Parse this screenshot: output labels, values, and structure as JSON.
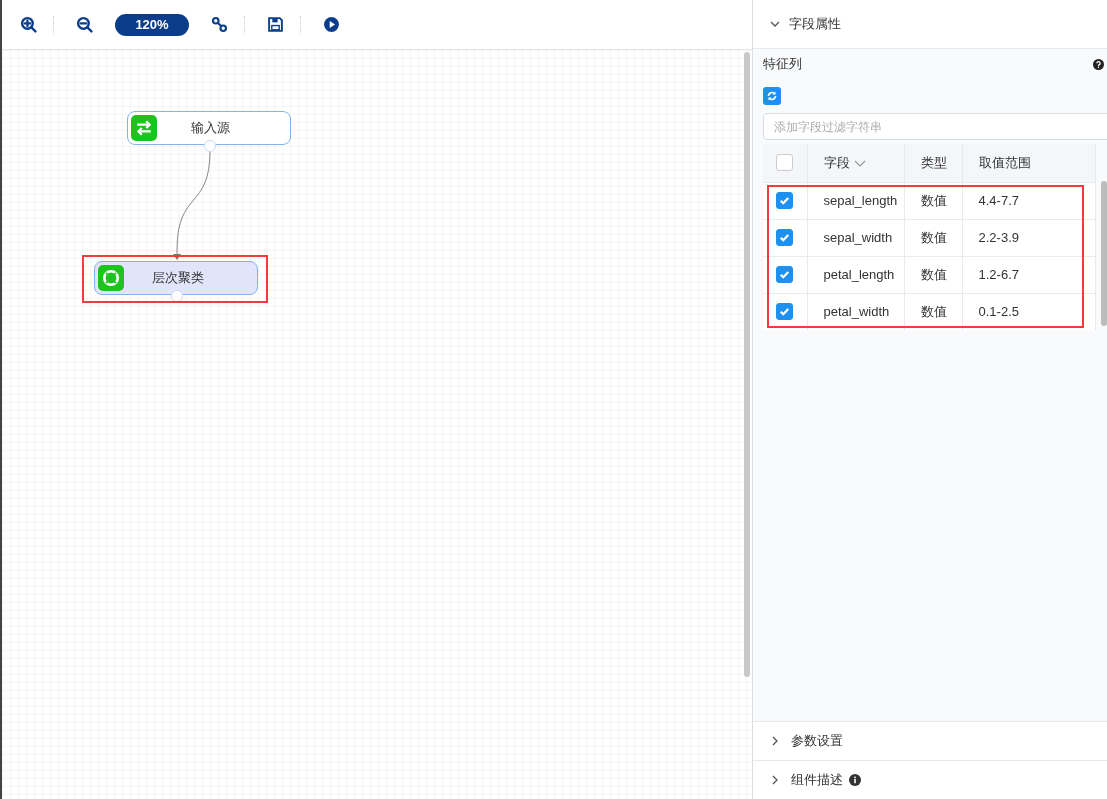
{
  "toolbar": {
    "zoom": "120%"
  },
  "canvas": {
    "nodes": [
      {
        "label": "输入源",
        "kind": "source",
        "selected": false
      },
      {
        "label": "层次聚类",
        "kind": "cluster",
        "selected": true
      }
    ]
  },
  "panel": {
    "section_title": "字段属性",
    "expanded": true,
    "group_label": "特征列",
    "filter": {
      "placeholder": "添加字段过滤字符串"
    },
    "table": {
      "columns": [
        "字段",
        "类型",
        "取值范围"
      ],
      "all_checked": false,
      "rows": [
        {
          "field": "sepal_length",
          "type": "数值",
          "range": "4.4-7.7",
          "checked": true
        },
        {
          "field": "sepal_width",
          "type": "数值",
          "range": "2.2-3.9",
          "checked": true
        },
        {
          "field": "petal_length",
          "type": "数值",
          "range": "1.2-6.7",
          "checked": true
        },
        {
          "field": "petal_width",
          "type": "数值",
          "range": "0.1-2.5",
          "checked": true
        }
      ]
    }
  },
  "collapsed_sections": [
    {
      "title": "参数设置",
      "info": false
    },
    {
      "title": "组件描述",
      "info": true
    }
  ]
}
